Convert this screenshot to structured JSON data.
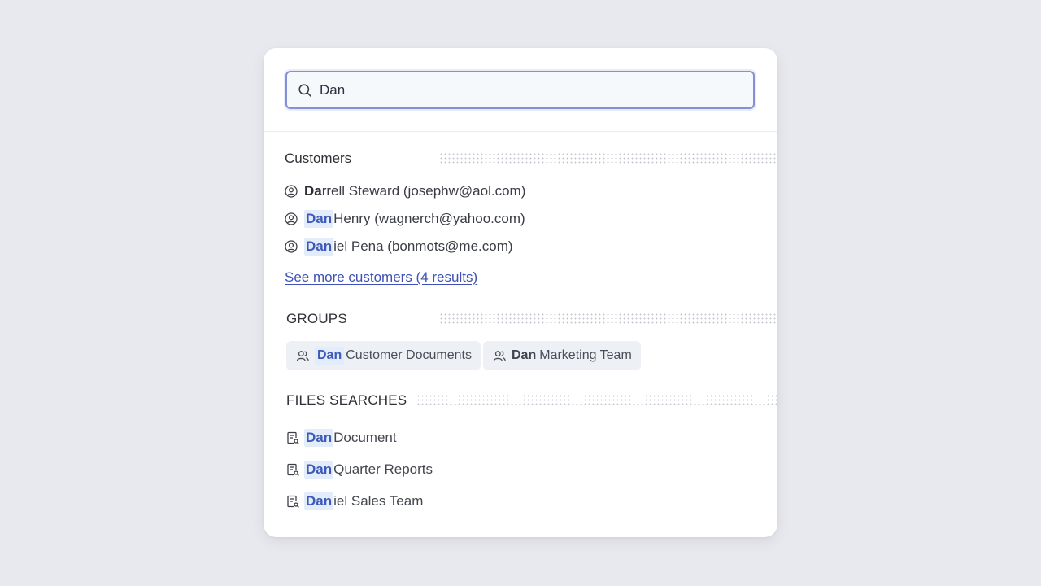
{
  "search": {
    "value": "Dan",
    "placeholder": ""
  },
  "customers": {
    "title": "Customers",
    "items": [
      {
        "match": "Da",
        "rest": "rrell Steward (josephw@aol.com)"
      },
      {
        "match": "Dan",
        "rest": " Henry (wagnerch@yahoo.com)"
      },
      {
        "match": "Dan",
        "rest": "iel Pena (bonmots@me.com)"
      }
    ],
    "see_more": "See more customers (4 results)"
  },
  "groups": {
    "title": "GROUPS",
    "items": [
      {
        "match": "Dan",
        "rest": "Customer Documents"
      },
      {
        "match": "Dan",
        "rest": "Marketing Team"
      }
    ]
  },
  "files": {
    "title": "FILES SEARCHES",
    "items": [
      {
        "match": "Dan",
        "rest": " Document"
      },
      {
        "match": "Dan",
        "rest": " Quarter Reports"
      },
      {
        "match": "Dan",
        "rest": "iel Sales Team"
      }
    ]
  },
  "icons": {
    "search": "search-icon",
    "customer": "user-circle-icon",
    "group": "users-icon",
    "file": "file-search-icon"
  },
  "colors": {
    "highlight_bg": "#e3ecfb",
    "highlight_text": "#3d5ab8",
    "link": "#3f51b5",
    "focus_border": "#8590d6"
  }
}
